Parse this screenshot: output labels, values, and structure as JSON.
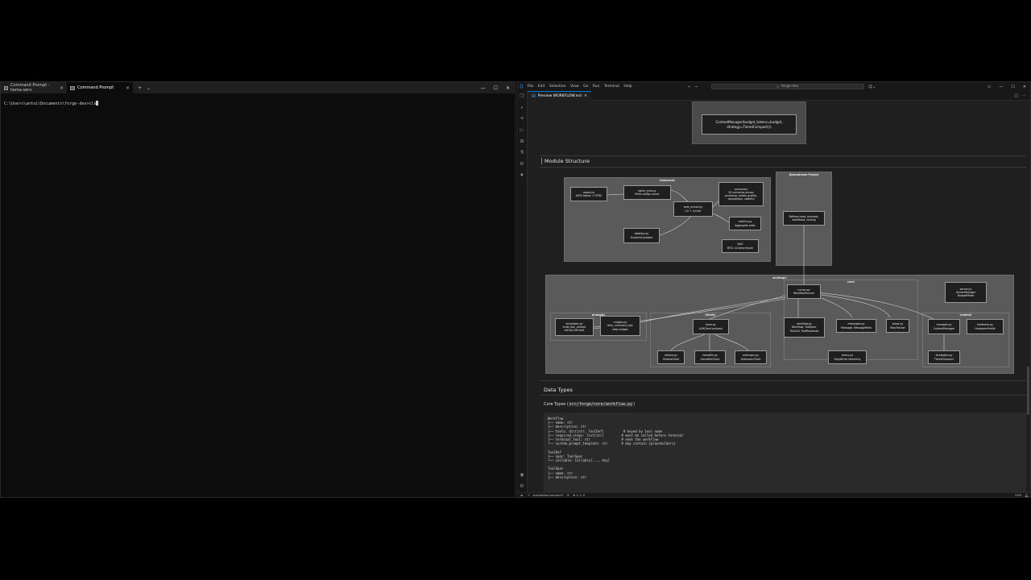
{
  "terminal": {
    "tabs": [
      {
        "label": "Command Prompt - llama-serv",
        "active": false
      },
      {
        "label": "Command Prompt",
        "active": true
      }
    ],
    "new_tab": "+",
    "dropdown": "⌄",
    "prompt_line": "C:\\Users\\antoi\\Documents\\forge-dev>cls"
  },
  "vscode": {
    "menu": [
      "File",
      "Edit",
      "Selection",
      "View",
      "Go",
      "Run",
      "Terminal",
      "Help"
    ],
    "search": "forge-dev",
    "tab": {
      "label": "Preview WORKFLOW.md"
    },
    "statusbar": {
      "branch": "worktable/compact*",
      "problems": "⊗ 0 ⚠ 0",
      "right": "OVR"
    }
  },
  "preview": {
    "top_node": [
      "ContextManager(budget_tokens=budget,",
      "strategy=TieredCompact())"
    ],
    "module_structure": "Module Structure",
    "diagram": {
      "tests_eval": "tests/eval/",
      "downstream": "Downstream Project",
      "downstream_node": [
        "Defines tools, prompts,",
        "workflows, routing"
      ],
      "src_forge": "src/forge/",
      "core": "core/",
      "prompts": "prompts/",
      "clients": "clients/",
      "context": "context/",
      "nodes": {
        "report": [
          "report.py",
          "ASCII tables + HTML"
        ],
        "batch_eval": [
          "batch_eval.py",
          "Multi-config runner"
        ],
        "scenarios": [
          "scenarios/",
          "20 scenarios across",
          "plumbing, model_quality,",
          "compaction, stateful"
        ],
        "eval_runner": [
          "eval_runner.py",
          "CLI + runner"
        ],
        "metrics": [
          "metrics.py",
          "Aggregate stats"
        ],
        "ablation": [
          "ablation.py",
          "Guardrail presets"
        ],
        "bfcl": [
          "bfcl/",
          "BFCL v4 benchmark"
        ],
        "runner": [
          "runner.py",
          "WorkflowRunner"
        ],
        "server": [
          "server.py",
          "ServerManager",
          "BudgetMode"
        ],
        "templates": [
          "templates.py",
          "build_tool_prompt",
          "extract,retrieve"
        ],
        "nudges": [
          "nudges.py",
          "retry, unknown_tool,",
          "step nudges"
        ],
        "base": [
          "base.py",
          "LLMClient protocol"
        ],
        "workflow": [
          "workflow.py",
          "Workflow, ToolSpec,",
          "ToolCall, TextResponse"
        ],
        "messages": [
          "messages.py",
          "Message, MessageMeta"
        ],
        "steps": [
          "steps.py",
          "StepTracker"
        ],
        "manager": [
          "manager.py",
          "ContextManager"
        ],
        "hardware": [
          "hardware.py",
          "HardwareProfile"
        ],
        "ollama": [
          "ollama.py",
          "OllamaClient"
        ],
        "llamafile": [
          "llamafile.py",
          "LlamafileClient"
        ],
        "anthropic": [
          "anthropic.py",
          "AnthropicClient"
        ],
        "errors": [
          "errors.py",
          "ForgeError hierarchy"
        ],
        "strategies": [
          "strategies.py",
          "TieredCompact"
        ]
      }
    },
    "data_types": "Data Types",
    "core_types_prefix": "Core Types (",
    "core_types_path": "src/forge/core/workflow.py",
    "core_types_suffix": ")",
    "code_lines": [
      "Workflow",
      "├── name: str",
      "├── description: str",
      "├── tools: dict[str, ToolDef]          # keyed by tool name",
      "├── required_steps: list[str]         # must be called before terminal",
      "├── terminal_tool: str                # ends the workflow",
      "└── system_prompt_template: str       # may contain {placeholders}",
      "",
      "ToolDef",
      "├── spec: ToolSpec",
      "└── callable: Callable[..., Any]",
      "",
      "ToolSpec",
      "├── name: str",
      "├── description: str"
    ]
  }
}
